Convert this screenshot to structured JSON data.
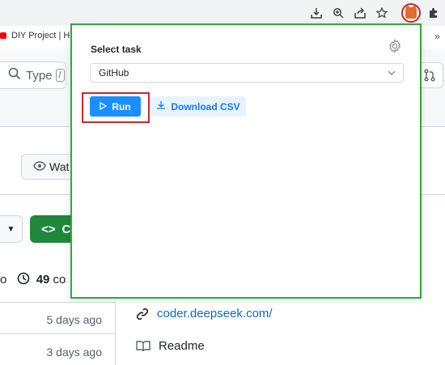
{
  "browser": {
    "bookmark_label": "DIY Project | How",
    "more_label": "»",
    "toolbar_icons": [
      "download-icon",
      "zoom-icon",
      "share-icon",
      "star-icon",
      "extension-fox-icon",
      "puzzle-icon"
    ]
  },
  "github": {
    "search_placeholder": "Type",
    "search_shortcut": "/",
    "watch_label": "Wat",
    "code_label": "Co",
    "commits_prefix": "o",
    "commits_count": "49",
    "commits_suffix": "co",
    "file_rows": [
      {
        "age": "5 days ago"
      },
      {
        "age": "3 days ago"
      }
    ],
    "about_link": "coder.deepseek.com/",
    "readme_label": "Readme"
  },
  "popup": {
    "title": "Select task",
    "selected_task": "GitHub",
    "run_label": "Run",
    "download_label": "Download CSV",
    "accent_color": "#1890ff",
    "border_color": "#2eaa3c"
  }
}
